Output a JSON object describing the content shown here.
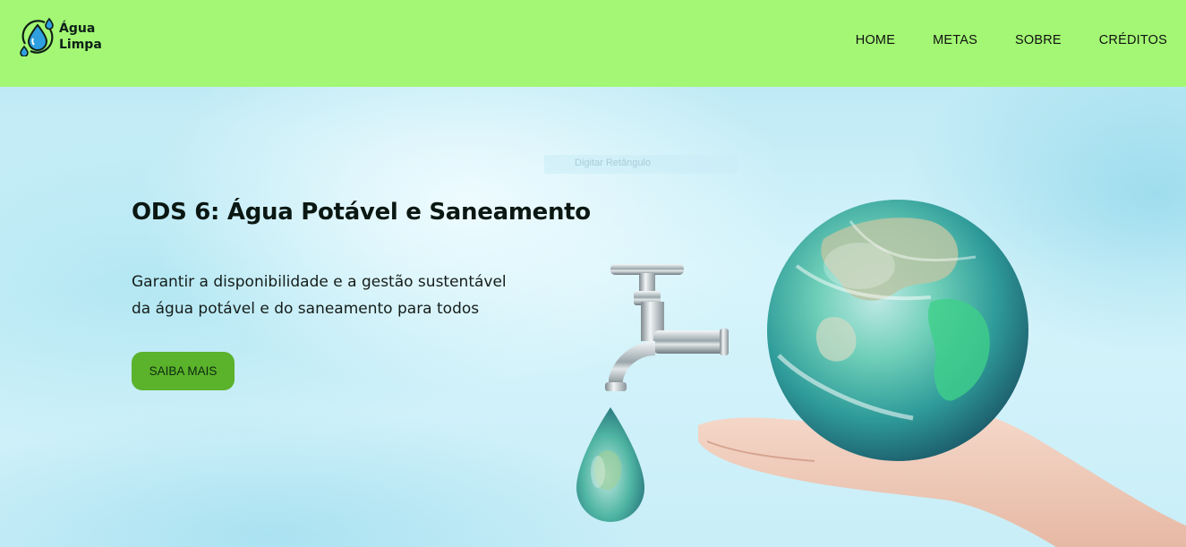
{
  "brand": {
    "name_line1": "Água",
    "name_line2": "Limpa",
    "logo_icon": "water-drops-icon"
  },
  "nav": {
    "items": [
      {
        "label": "HOME"
      },
      {
        "label": "METAS"
      },
      {
        "label": "SOBRE"
      },
      {
        "label": "CRÉDITOS"
      }
    ]
  },
  "hero": {
    "title": "ODS 6: Água Potável e Saneamento",
    "subtitle_line1": "Garantir a disponibilidade e a gestão sustentável",
    "subtitle_line2": "da água potável e do saneamento para todos",
    "cta_label": "SAIBA MAIS",
    "ghost_text": "Digitar Retângulo",
    "illustration": "globe-faucet-hand-image"
  },
  "colors": {
    "header_bg": "#a3f774",
    "button_bg": "#5bb22b",
    "hero_bg": "#d6f4fb"
  }
}
